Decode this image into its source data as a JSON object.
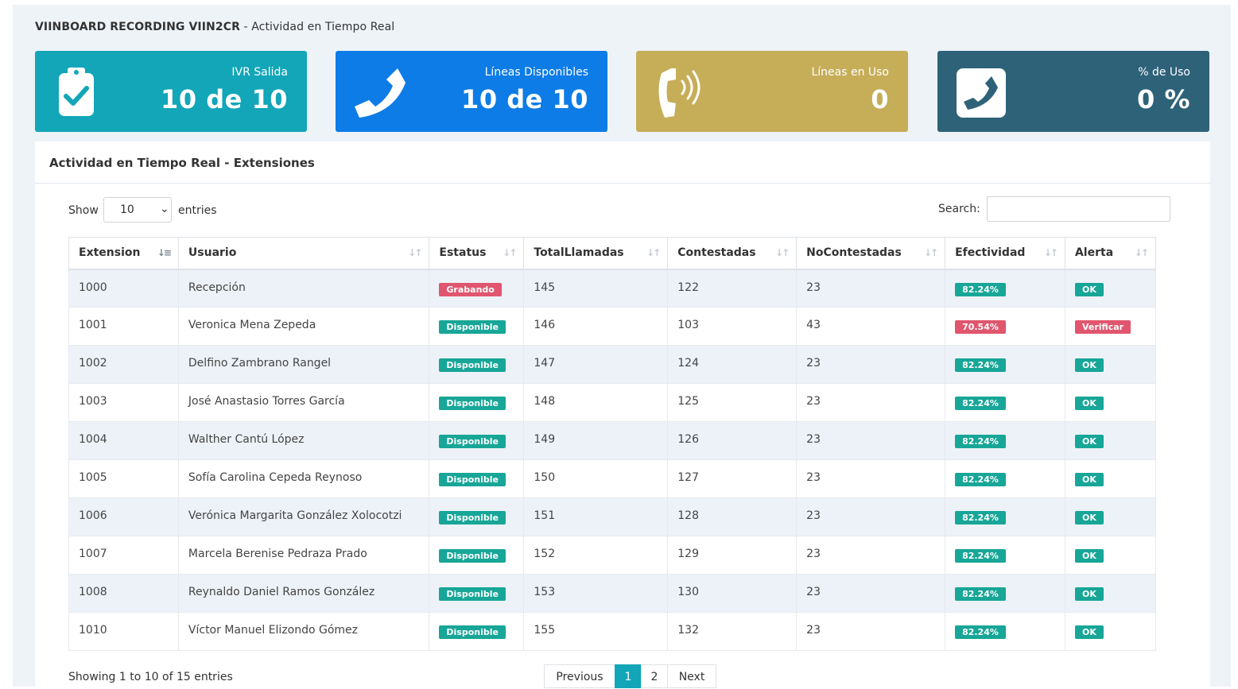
{
  "page": {
    "title_strong": "VIINBOARD RECORDING VIIN2CR",
    "title_rest": " - Actividad en Tiempo Real"
  },
  "cards": [
    {
      "label": "IVR Salida",
      "value": "10 de 10",
      "color": "#12a6b8",
      "icon": "clipboard-check-icon"
    },
    {
      "label": "Líneas Disponibles",
      "value": "10 de 10",
      "color": "#0d7ce6",
      "icon": "phone-icon"
    },
    {
      "label": "Líneas en Uso",
      "value": "0",
      "color": "#c6ad58",
      "icon": "phone-ringing-icon"
    },
    {
      "label": "% de Uso",
      "value": "0 %",
      "color": "#2d6279",
      "icon": "phone-square-icon"
    }
  ],
  "panel": {
    "title": "Actividad en Tiempo Real - Extensiones",
    "show_label": "Show",
    "show_value": "10",
    "entries_label": "entries",
    "search_label": "Search:",
    "search_value": ""
  },
  "table": {
    "headers": [
      "Extension",
      "Usuario",
      "Estatus",
      "TotalLlamadas",
      "Contestadas",
      "NoContestadas",
      "Efectividad",
      "Alerta"
    ],
    "rows": [
      {
        "ext": "1000",
        "user": "Recepción",
        "status": "Grabando",
        "total": "145",
        "cont": "122",
        "nocont": "23",
        "efect": "82.24%",
        "alert": "OK"
      },
      {
        "ext": "1001",
        "user": "Veronica Mena Zepeda",
        "status": "Disponible",
        "total": "146",
        "cont": "103",
        "nocont": "43",
        "efect": "70.54%",
        "alert": "Verificar"
      },
      {
        "ext": "1002",
        "user": "Delfino Zambrano Rangel",
        "status": "Disponible",
        "total": "147",
        "cont": "124",
        "nocont": "23",
        "efect": "82.24%",
        "alert": "OK"
      },
      {
        "ext": "1003",
        "user": "José Anastasio Torres García",
        "status": "Disponible",
        "total": "148",
        "cont": "125",
        "nocont": "23",
        "efect": "82.24%",
        "alert": "OK"
      },
      {
        "ext": "1004",
        "user": "Walther Cantú López",
        "status": "Disponible",
        "total": "149",
        "cont": "126",
        "nocont": "23",
        "efect": "82.24%",
        "alert": "OK"
      },
      {
        "ext": "1005",
        "user": "Sofía Carolina Cepeda Reynoso",
        "status": "Disponible",
        "total": "150",
        "cont": "127",
        "nocont": "23",
        "efect": "82.24%",
        "alert": "OK"
      },
      {
        "ext": "1006",
        "user": "Verónica Margarita González Xolocotzi",
        "status": "Disponible",
        "total": "151",
        "cont": "128",
        "nocont": "23",
        "efect": "82.24%",
        "alert": "OK"
      },
      {
        "ext": "1007",
        "user": "Marcela Berenise Pedraza Prado",
        "status": "Disponible",
        "total": "152",
        "cont": "129",
        "nocont": "23",
        "efect": "82.24%",
        "alert": "OK"
      },
      {
        "ext": "1008",
        "user": "Reynaldo Daniel Ramos González",
        "status": "Disponible",
        "total": "153",
        "cont": "130",
        "nocont": "23",
        "efect": "82.24%",
        "alert": "OK"
      },
      {
        "ext": "1010",
        "user": "Víctor Manuel Elizondo Gómez",
        "status": "Disponible",
        "total": "155",
        "cont": "132",
        "nocont": "23",
        "efect": "82.24%",
        "alert": "OK"
      }
    ]
  },
  "footer": {
    "info": "Showing 1 to 10 of 15 entries",
    "prev": "Previous",
    "page1": "1",
    "page2": "2",
    "next": "Next"
  },
  "colors": {
    "badge_ok": "#17a697",
    "badge_alert": "#e0566e",
    "accent": "#12a6b8"
  }
}
